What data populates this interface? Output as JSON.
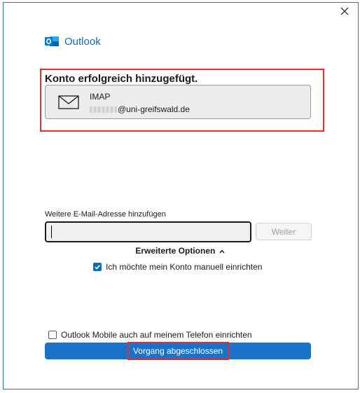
{
  "app": {
    "name": "Outlook",
    "brand_color": "#0f6cbd"
  },
  "dialog": {
    "close_icon": "close-icon",
    "success_title": "Konto erfolgreich hinzugefügt.",
    "account": {
      "type": "IMAP",
      "email_domain": "@uni-greifswald.de",
      "icon": "mail-icon"
    },
    "add_email": {
      "label": "Weitere E-Mail-Adresse hinzufügen",
      "value": "",
      "next_label": "Weiter"
    },
    "advanced_options": {
      "label": "Erweiterte Optionen",
      "chevron": "chevron-up-icon",
      "manual_setup": {
        "label": "Ich möchte mein Konto manuell einrichten",
        "checked": true
      }
    },
    "mobile_setup": {
      "label": "Outlook Mobile auch auf meinem Telefon einrichten",
      "checked": false
    },
    "finish_label": "Vorgang abgeschlossen",
    "highlight_color": "#e03131",
    "primary_button_color": "#1a73c9"
  }
}
